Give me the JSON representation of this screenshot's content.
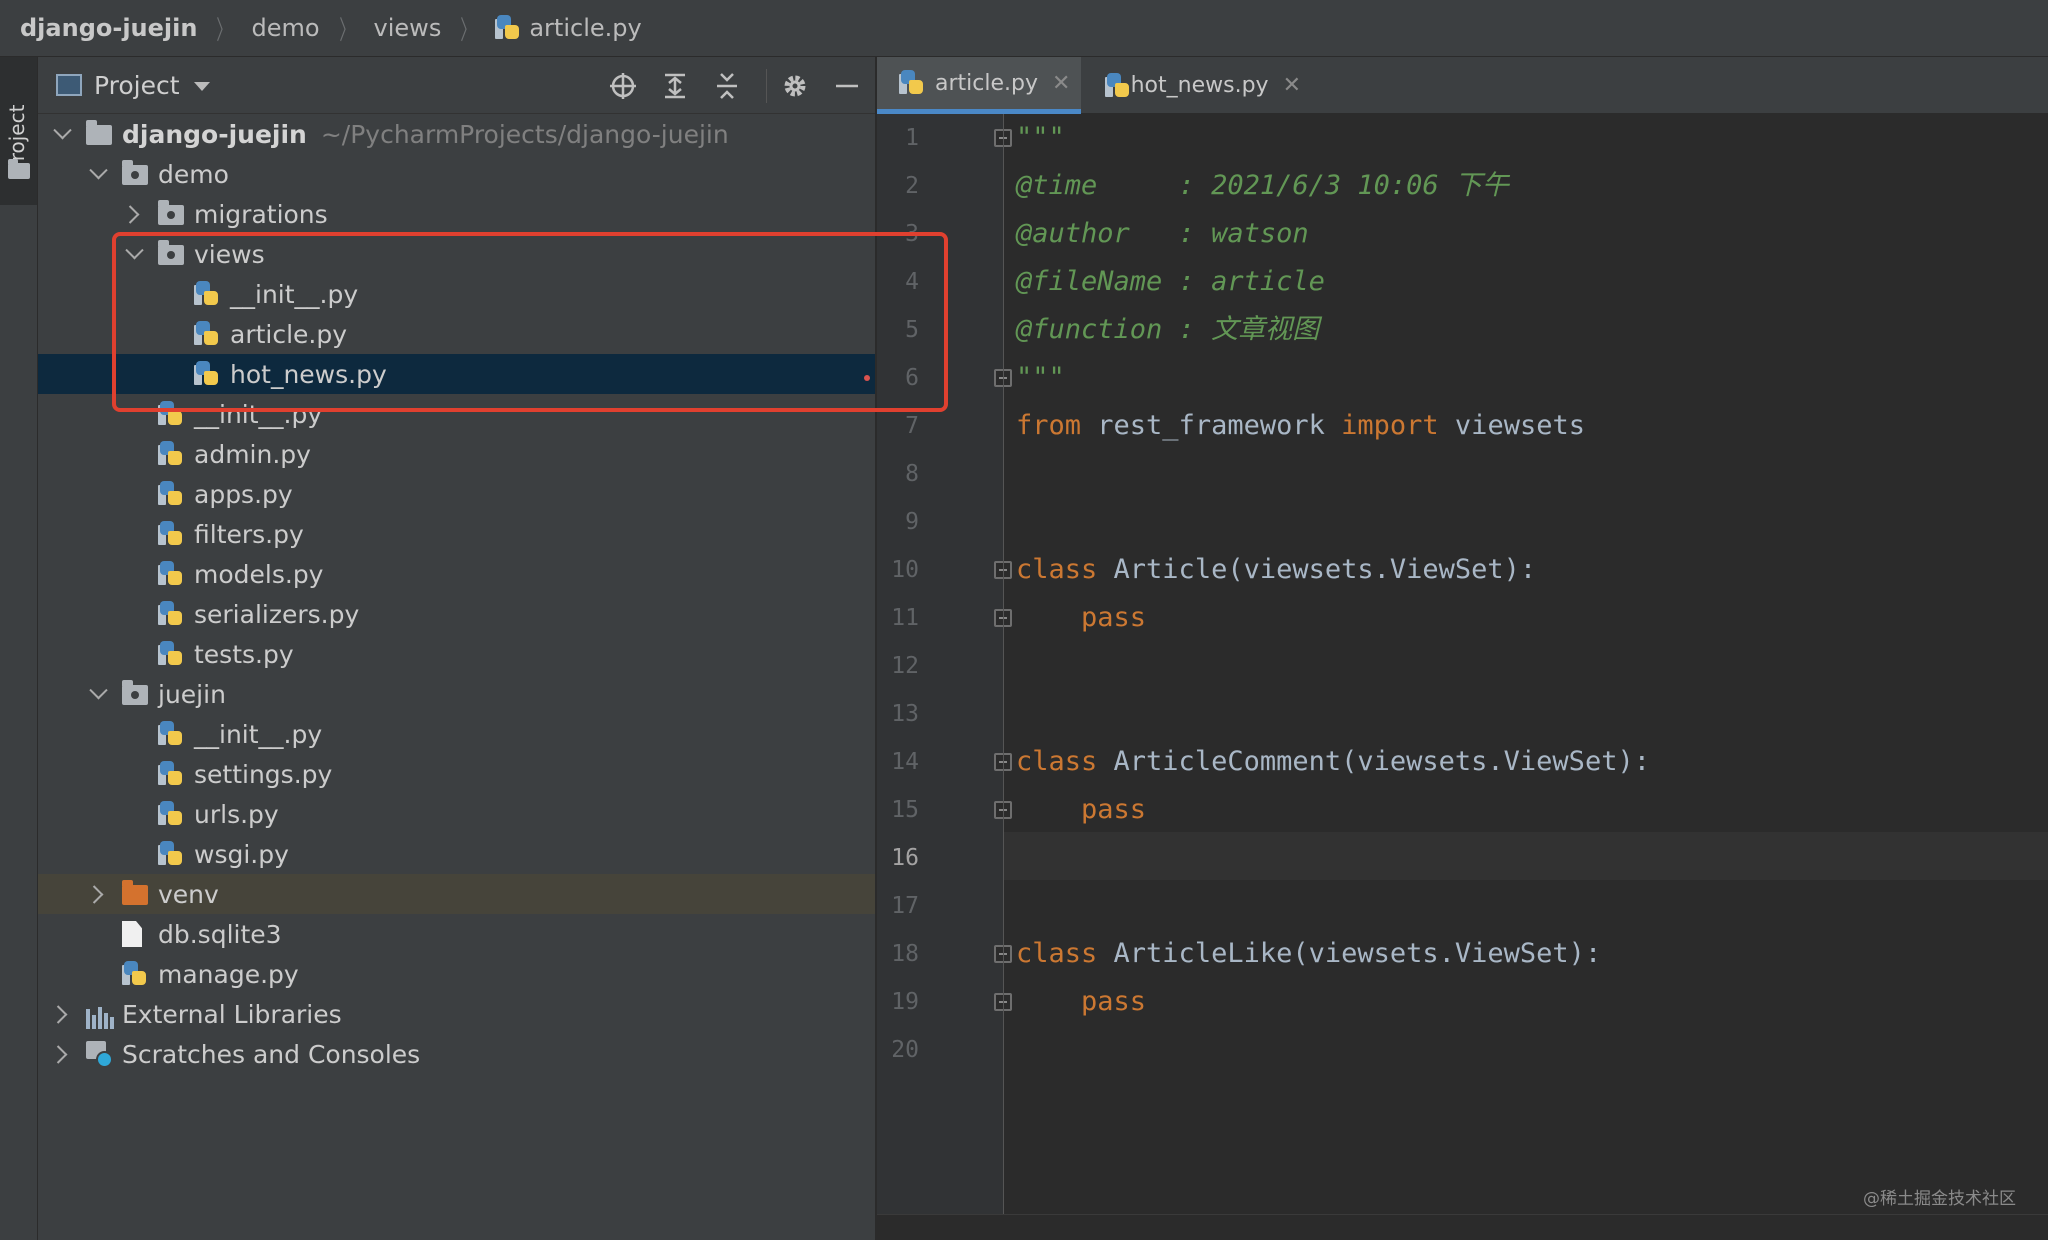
{
  "breadcrumb": {
    "items": [
      "django-juejin",
      "demo",
      "views",
      "article.py"
    ]
  },
  "toolstrip": {
    "project_label": "Project"
  },
  "project_panel": {
    "title": "Project",
    "tree": [
      {
        "label": "django-juejin",
        "hint": "~/PycharmProjects/django-juejin",
        "type": "folder",
        "expanded": true,
        "depth": 0
      },
      {
        "label": "demo",
        "type": "folder",
        "expanded": true,
        "depth": 1
      },
      {
        "label": "migrations",
        "type": "folder",
        "expanded": false,
        "depth": 2
      },
      {
        "label": "views",
        "type": "folder",
        "expanded": true,
        "depth": 2
      },
      {
        "label": "__init__.py",
        "type": "py",
        "depth": 3
      },
      {
        "label": "article.py",
        "type": "py",
        "depth": 3
      },
      {
        "label": "hot_news.py",
        "type": "py",
        "depth": 3,
        "selected": true
      },
      {
        "label": "__init__.py",
        "type": "py",
        "depth": 2
      },
      {
        "label": "admin.py",
        "type": "py",
        "depth": 2
      },
      {
        "label": "apps.py",
        "type": "py",
        "depth": 2
      },
      {
        "label": "filters.py",
        "type": "py",
        "depth": 2
      },
      {
        "label": "models.py",
        "type": "py",
        "depth": 2
      },
      {
        "label": "serializers.py",
        "type": "py",
        "depth": 2
      },
      {
        "label": "tests.py",
        "type": "py",
        "depth": 2
      },
      {
        "label": "juejin",
        "type": "folder",
        "expanded": true,
        "depth": 1
      },
      {
        "label": "__init__.py",
        "type": "py",
        "depth": 2
      },
      {
        "label": "settings.py",
        "type": "py",
        "depth": 2
      },
      {
        "label": "urls.py",
        "type": "py",
        "depth": 2
      },
      {
        "label": "wsgi.py",
        "type": "py",
        "depth": 2
      },
      {
        "label": "venv",
        "type": "folder-orange",
        "expanded": false,
        "depth": 1
      },
      {
        "label": "db.sqlite3",
        "type": "file",
        "depth": 1
      },
      {
        "label": "manage.py",
        "type": "py",
        "depth": 1
      },
      {
        "label": "External Libraries",
        "type": "lib",
        "expanded": false,
        "depth": 0
      },
      {
        "label": "Scratches and Consoles",
        "type": "scratch",
        "expanded": false,
        "depth": 0
      }
    ]
  },
  "tabs": [
    {
      "label": "article.py",
      "active": true
    },
    {
      "label": "hot_news.py",
      "active": false
    }
  ],
  "tab_close_glyph": "✕",
  "editor": {
    "line_numbers": [
      "1",
      "2",
      "3",
      "4",
      "5",
      "6",
      "7",
      "8",
      "9",
      "10",
      "11",
      "12",
      "13",
      "14",
      "15",
      "16",
      "17",
      "18",
      "19",
      "20"
    ],
    "current_line": "16",
    "lines": [
      [
        {
          "t": "\"\"\"",
          "c": "doc"
        }
      ],
      [
        {
          "t": "@time     : 2021/6/3 10:06 下午",
          "c": "doc"
        }
      ],
      [
        {
          "t": "@author   : watson",
          "c": "doc"
        }
      ],
      [
        {
          "t": "@fileName : article",
          "c": "doc"
        }
      ],
      [
        {
          "t": "@function : 文章视图",
          "c": "doc"
        }
      ],
      [
        {
          "t": "\"\"\"",
          "c": "doc"
        }
      ],
      [
        {
          "t": "from",
          "c": "kw"
        },
        {
          "t": " rest_framework ",
          "c": ""
        },
        {
          "t": "import",
          "c": "kw"
        },
        {
          "t": " viewsets",
          "c": ""
        }
      ],
      [],
      [],
      [
        {
          "t": "class",
          "c": "kw"
        },
        {
          "t": " Article(viewsets.ViewSet):",
          "c": ""
        }
      ],
      [
        {
          "t": "    ",
          "c": ""
        },
        {
          "t": "pass",
          "c": "kw"
        }
      ],
      [],
      [],
      [
        {
          "t": "class",
          "c": "kw"
        },
        {
          "t": " ArticleComment(viewsets.ViewSet):",
          "c": ""
        }
      ],
      [
        {
          "t": "    ",
          "c": ""
        },
        {
          "t": "pass",
          "c": "kw"
        }
      ],
      [],
      [],
      [
        {
          "t": "class",
          "c": "kw"
        },
        {
          "t": " ArticleLike(viewsets.ViewSet):",
          "c": ""
        }
      ],
      [
        {
          "t": "    ",
          "c": ""
        },
        {
          "t": "pass",
          "c": "kw"
        }
      ],
      []
    ]
  },
  "watermark": "@稀土掘金技术社区",
  "colors": {
    "keyword": "#cc7832",
    "docstring": "#629755",
    "highlight_box": "#e0402f",
    "selection": "#0d293e"
  }
}
